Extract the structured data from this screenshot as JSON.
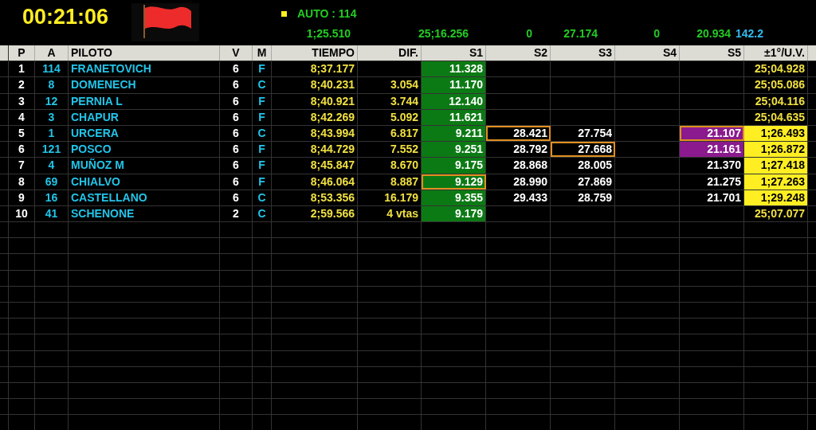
{
  "clock": "00:21:06",
  "flag": {
    "color": "#ee2b2b"
  },
  "car_label": "AUTO : 114",
  "car_stats": [
    {
      "text": "1;25.510",
      "color": "#22cc22"
    },
    {
      "text": "25;16.256",
      "color": "#22cc22"
    },
    {
      "text": "0",
      "color": "#22cc22"
    },
    {
      "text": "27.174",
      "color": "#22cc22"
    },
    {
      "text": "0",
      "color": "#22cc22"
    },
    {
      "text": "20.934",
      "color": "#22cc22"
    },
    {
      "text": "142.2",
      "color": "#33bbee"
    }
  ],
  "table": {
    "columns": [
      "P",
      "A",
      "PILOTO",
      "V",
      "M",
      "TIEMPO",
      "DIF.",
      "S1",
      "S2",
      "S3",
      "S4",
      "S5",
      "±1°/U.V."
    ],
    "rows": [
      {
        "p": "1",
        "a": "114",
        "piloto": "FRANETOVICH",
        "v": "6",
        "m": "F",
        "tiempo": "8;37.177",
        "sectors": [
          {
            "text": "11.328",
            "kind": "green",
            "outlined": false
          },
          {
            "kind": "plain",
            "outlined": false
          },
          {
            "kind": "plain",
            "outlined": false
          },
          {
            "kind": "plain",
            "outlined": false
          },
          {
            "kind": "plain",
            "outlined": false
          }
        ],
        "last": {
          "text": "25;04.928",
          "kind": "plain"
        }
      },
      {
        "p": "2",
        "a": "8",
        "piloto": "DOMENECH",
        "v": "6",
        "m": "C",
        "tiempo": "8;40.231",
        "dif": "3.054",
        "sectors": [
          {
            "text": "11.170",
            "kind": "green",
            "outlined": false
          },
          {
            "kind": "plain",
            "outlined": false
          },
          {
            "kind": "plain",
            "outlined": false
          },
          {
            "kind": "plain",
            "outlined": false
          },
          {
            "kind": "plain",
            "outlined": false
          }
        ],
        "last": {
          "text": "25;05.086",
          "kind": "plain"
        }
      },
      {
        "p": "3",
        "a": "12",
        "piloto": "PERNIA L",
        "v": "6",
        "m": "F",
        "tiempo": "8;40.921",
        "dif": "3.744",
        "sectors": [
          {
            "text": "12.140",
            "kind": "green",
            "outlined": false
          },
          {
            "kind": "plain",
            "outlined": false
          },
          {
            "kind": "plain",
            "outlined": false
          },
          {
            "kind": "plain",
            "outlined": false
          },
          {
            "kind": "plain",
            "outlined": false
          }
        ],
        "last": {
          "text": "25;04.116",
          "kind": "plain"
        }
      },
      {
        "p": "4",
        "a": "3",
        "piloto": "CHAPUR",
        "v": "6",
        "m": "F",
        "tiempo": "8;42.269",
        "dif": "5.092",
        "sectors": [
          {
            "text": "11.621",
            "kind": "green",
            "outlined": false
          },
          {
            "kind": "plain",
            "outlined": false
          },
          {
            "kind": "plain",
            "outlined": false
          },
          {
            "kind": "plain",
            "outlined": false
          },
          {
            "kind": "plain",
            "outlined": false
          }
        ],
        "last": {
          "text": "25;04.635",
          "kind": "plain"
        }
      },
      {
        "p": "5",
        "a": "1",
        "piloto": "URCERA",
        "v": "6",
        "m": "C",
        "tiempo": "8;43.994",
        "dif": "6.817",
        "sectors": [
          {
            "text": "9.211",
            "kind": "green",
            "outlined": false
          },
          {
            "text": "28.421",
            "kind": "plain",
            "outlined": true
          },
          {
            "text": "27.754",
            "kind": "plain",
            "outlined": false
          },
          {
            "kind": "plain",
            "outlined": false
          },
          {
            "text": "21.107",
            "kind": "purple",
            "outlined": true
          }
        ],
        "last": {
          "text": "1;26.493",
          "kind": "yellow"
        }
      },
      {
        "p": "6",
        "a": "121",
        "piloto": "POSCO",
        "v": "6",
        "m": "F",
        "tiempo": "8;44.729",
        "dif": "7.552",
        "sectors": [
          {
            "text": "9.251",
            "kind": "green",
            "outlined": false
          },
          {
            "text": "28.792",
            "kind": "plain",
            "outlined": false
          },
          {
            "text": "27.668",
            "kind": "plain",
            "outlined": true
          },
          {
            "kind": "plain",
            "outlined": false
          },
          {
            "text": "21.161",
            "kind": "purple",
            "outlined": false
          }
        ],
        "last": {
          "text": "1;26.872",
          "kind": "yellow"
        }
      },
      {
        "p": "7",
        "a": "4",
        "piloto": "MUÑOZ M",
        "v": "6",
        "m": "F",
        "tiempo": "8;45.847",
        "dif": "8.670",
        "sectors": [
          {
            "text": "9.175",
            "kind": "green",
            "outlined": false
          },
          {
            "text": "28.868",
            "kind": "plain",
            "outlined": false
          },
          {
            "text": "28.005",
            "kind": "plain",
            "outlined": false
          },
          {
            "kind": "plain",
            "outlined": false
          },
          {
            "text": "21.370",
            "kind": "plain",
            "outlined": false
          }
        ],
        "last": {
          "text": "1;27.418",
          "kind": "yellow"
        }
      },
      {
        "p": "8",
        "a": "69",
        "piloto": "CHIALVO",
        "v": "6",
        "m": "F",
        "tiempo": "8;46.064",
        "dif": "8.887",
        "sectors": [
          {
            "text": "9.129",
            "kind": "green",
            "outlined": true
          },
          {
            "text": "28.990",
            "kind": "plain",
            "outlined": false
          },
          {
            "text": "27.869",
            "kind": "plain",
            "outlined": false
          },
          {
            "kind": "plain",
            "outlined": false
          },
          {
            "text": "21.275",
            "kind": "plain",
            "outlined": false
          }
        ],
        "last": {
          "text": "1;27.263",
          "kind": "yellow"
        }
      },
      {
        "p": "9",
        "a": "16",
        "piloto": "CASTELLANO",
        "v": "6",
        "m": "C",
        "tiempo": "8;53.356",
        "dif": "16.179",
        "sectors": [
          {
            "text": "9.355",
            "kind": "green",
            "outlined": false
          },
          {
            "text": "29.433",
            "kind": "plain",
            "outlined": false
          },
          {
            "text": "28.759",
            "kind": "plain",
            "outlined": false
          },
          {
            "kind": "plain",
            "outlined": false
          },
          {
            "text": "21.701",
            "kind": "plain",
            "outlined": false
          }
        ],
        "last": {
          "text": "1;29.248",
          "kind": "yellow"
        }
      },
      {
        "p": "10",
        "a": "41",
        "piloto": "SCHENONE",
        "v": "2",
        "m": "C",
        "tiempo": "2;59.566",
        "dif": "4 vtas",
        "sectors": [
          {
            "text": "9.179",
            "kind": "green",
            "outlined": false
          },
          {
            "kind": "plain",
            "outlined": false
          },
          {
            "kind": "plain",
            "outlined": false
          },
          {
            "kind": "plain",
            "outlined": false
          },
          {
            "kind": "plain",
            "outlined": false
          }
        ],
        "last": {
          "text": "25;07.077",
          "kind": "plain"
        }
      }
    ]
  }
}
